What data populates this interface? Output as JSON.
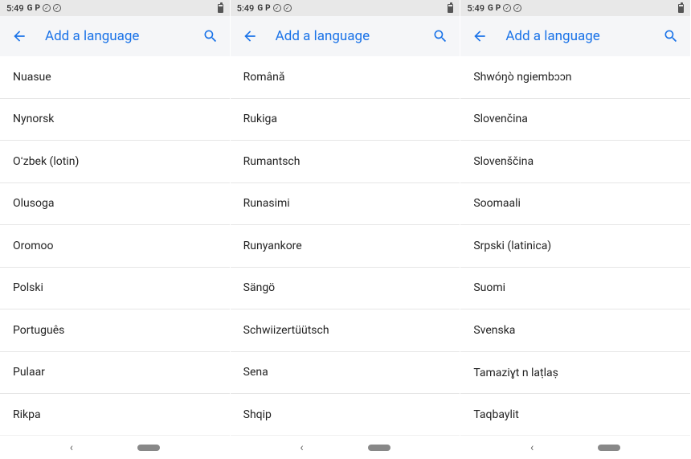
{
  "status_bar": {
    "time": "5:49",
    "icons": [
      "G",
      "P"
    ]
  },
  "app_bar": {
    "title": "Add a language"
  },
  "screens": [
    {
      "languages": [
        "Nuasue",
        "Nynorsk",
        "Oʻzbek (lotin)",
        "Olusoga",
        "Oromoo",
        "Polski",
        "Português",
        "Pulaar",
        "Rikpa"
      ]
    },
    {
      "languages": [
        "Română",
        "Rukiga",
        "Rumantsch",
        "Runasimi",
        "Runyankore",
        "Sängö",
        "Schwiizertüütsch",
        "Sena",
        "Shqip"
      ]
    },
    {
      "languages": [
        "Shwóŋò ngiembɔɔn",
        "Slovenčina",
        "Slovenščina",
        "Soomaali",
        "Srpski (latinica)",
        "Suomi",
        "Svenska",
        "Tamaziɣt n laṭlaṣ",
        "Taqbaylit"
      ]
    }
  ]
}
